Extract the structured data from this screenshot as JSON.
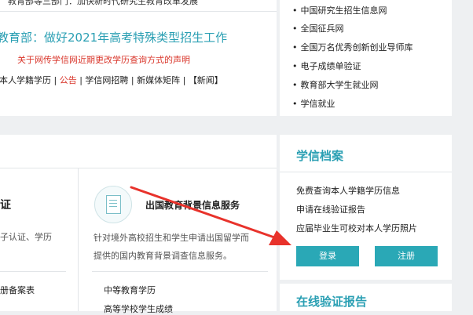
{
  "news": {
    "top_cut": "教育部等三部门：加快新时代研究生教育改革发展",
    "headline": "教育部：做好2021年高考特殊类型招生工作",
    "notice": "关于网传学信网近期更改学历查询方式的声明",
    "nav": {
      "a": "本人学籍学历",
      "sep1": " | ",
      "b": "公告",
      "sep2": " | ",
      "c": "学信网招聘",
      "sep3": " | ",
      "d": "新媒体矩阵",
      "sep4": " | ",
      "e": "【新闻】"
    }
  },
  "right_links": [
    "中国研究生招生信息网",
    "全国征兵网",
    "全国万名优秀创新创业导师库",
    "电子成绩单验证",
    "教育部大学生就业网",
    "学信就业"
  ],
  "services": {
    "left_title_cut": "证",
    "left_desc_cut": "子认证、学历",
    "left_item_cut": "册备案表",
    "icon": "certificate-icon",
    "title": "出国教育背景信息服务",
    "desc_line1": "针对境外高校招生和学生申请出国留学而",
    "desc_line2": "提供的国内教育背景调查信息服务。",
    "items": [
      "中等教育学历",
      "高等学校学生成绩"
    ]
  },
  "archive": {
    "title": "学信档案",
    "links": [
      "免费查询本人学籍学历信息",
      "申请在线验证报告",
      "应届毕业生可校对本人学历照片"
    ],
    "login": "登录",
    "register": "注册"
  },
  "verify": {
    "title": "在线验证报告"
  },
  "colors": {
    "accent": "#2aa8b6",
    "headline": "#2a9fb3",
    "alert": "#d9352a",
    "annotation_arrow": "#e8322b"
  }
}
